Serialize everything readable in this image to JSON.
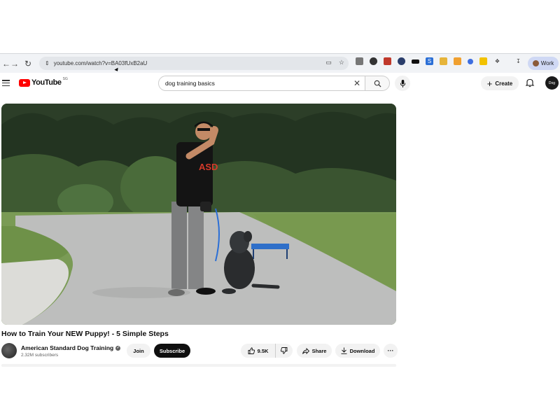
{
  "browser": {
    "url": "youtube.com/watch?v=BA03fUxB2aU",
    "profile_label": "Work"
  },
  "youtube": {
    "logo_text": "YouTube",
    "logo_country": "SG",
    "search_query": "dog training basics",
    "create_label": "Create",
    "account_initials": "Dog"
  },
  "video": {
    "title": "How to Train Your NEW Puppy! - 5 Simple Steps",
    "channel_name": "American Standard Dog Training",
    "subscribers": "2.32M subscribers",
    "join_label": "Join",
    "subscribe_label": "Subscribe",
    "like_count": "9.5K",
    "share_label": "Share",
    "download_label": "Download",
    "more_label": "···",
    "shirt_text": "ASD"
  },
  "icons": [
    "menu-icon",
    "search-icon",
    "mic-icon",
    "bell-icon",
    "like-icon",
    "dislike-icon",
    "share-icon",
    "download-icon",
    "back-icon",
    "forward-icon",
    "reload-icon",
    "cast-icon",
    "star-icon",
    "verified-icon"
  ],
  "colors": {
    "youtube_red": "#ff0000",
    "subscribe_bg": "#0f0f0f",
    "pill_bg": "#f2f2f2"
  }
}
